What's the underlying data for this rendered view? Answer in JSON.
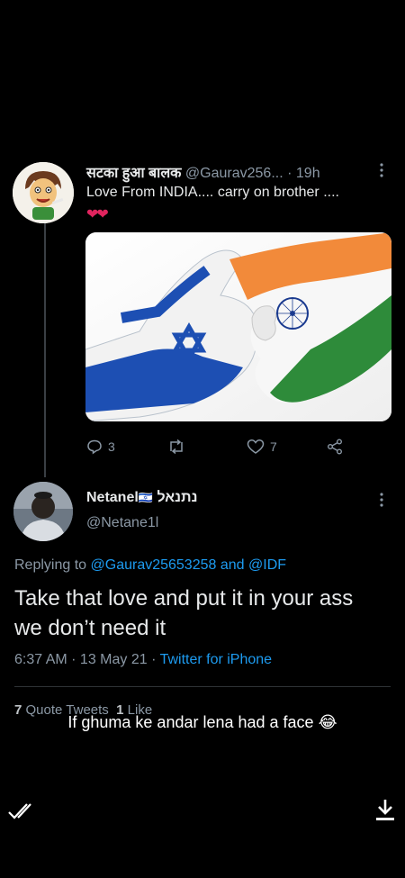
{
  "tweet1": {
    "display_name": "सटका हुआ बालक",
    "handle": "@Gaurav256...",
    "separator": "·",
    "time": "19h",
    "text": "Love From INDIA....  carry on brother ....",
    "hearts": "❤❤",
    "actions": {
      "replies": "3",
      "likes": "7"
    }
  },
  "tweet2": {
    "display_name": "Netanel",
    "flag": "🇮🇱",
    "hebrew_name": "נתנאל",
    "handle": "@Netane1l",
    "replying_prefix": "Replying to",
    "replying_user1": "@Gaurav25653258",
    "replying_and": "and",
    "replying_user2": "@IDF",
    "text": "Take that love and put it in your ass we don’t need it",
    "time": "6:37 AM · 13 May 21 ·",
    "source": "Twitter for iPhone",
    "quote_count": "7",
    "quote_label": "Quote Tweets",
    "like_count": "1",
    "like_label": "Like"
  },
  "caption": "If ghuma ke andar lena had a face 😂",
  "colors": {
    "background": "#000000",
    "link": "#1d9bf0",
    "muted": "#8b98a5",
    "heart": "#e0245e"
  },
  "icons": [
    "more-icon",
    "reply-icon",
    "retweet-icon",
    "like-icon",
    "share-icon",
    "double-check-icon",
    "download-icon"
  ]
}
